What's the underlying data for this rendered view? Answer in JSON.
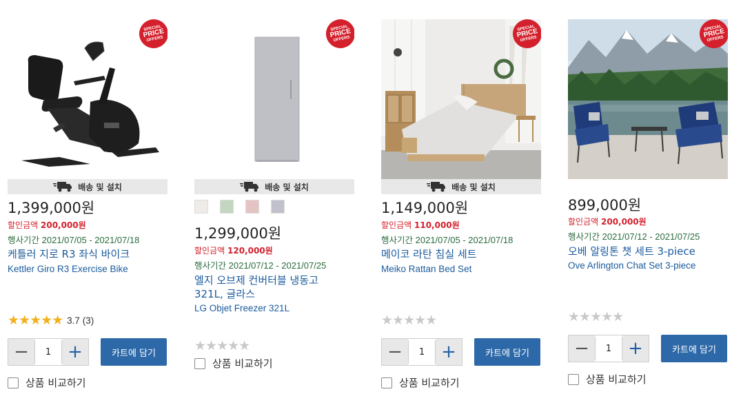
{
  "badge": {
    "line1": "SPECIAL",
    "line2": "PRICE",
    "line3": "OFFERS"
  },
  "shipping_label": "배송 및 설치",
  "cart_label": "카트에 담기",
  "compare_label": "상품 비교하기",
  "quantity_default": "1",
  "discount_label": "할인금액",
  "period_label": "행사기간",
  "stars_glyphs": "★★★★★",
  "products": [
    {
      "price": "1,399,000원",
      "discount": "200,000원",
      "period": "2021/07/05 - 2021/07/18",
      "name_ko": "케틀러 지로 R3 좌식 바이크",
      "name_en": "Kettler Giro R3 Exercise Bike",
      "rating": 5,
      "rating_text": "3.7",
      "review_count": "(3)"
    },
    {
      "price": "1,299,000원",
      "discount": "120,000원",
      "period": "2021/07/12 - 2021/07/25",
      "name_ko": "엘지 오브제 컨버터블 냉동고 321L, 글라스",
      "name_en": "LG Objet Freezer 321L",
      "rating": 0,
      "swatch_colors": [
        "#efebe7",
        "#c3d6c0",
        "#e6c3c3",
        "#c1c1cc"
      ]
    },
    {
      "price": "1,149,000원",
      "discount": "110,000원",
      "period": "2021/07/05 - 2021/07/18",
      "name_ko": "메이코 라탄 침실 세트",
      "name_en": "Meiko Rattan Bed Set",
      "rating": 0
    },
    {
      "price": "899,000원",
      "discount": "200,000원",
      "period": "2021/07/12 - 2021/07/25",
      "name_ko": "오베 알링톤 챗 세트 3-piece",
      "name_en": "Ove Arlington Chat Set 3-piece",
      "rating": 0
    }
  ],
  "colors": {
    "accent": "#2d68a8",
    "discount": "#d4202c",
    "period": "#2a6b3c",
    "link": "#1a5a9c",
    "star": "#f2b01e"
  }
}
